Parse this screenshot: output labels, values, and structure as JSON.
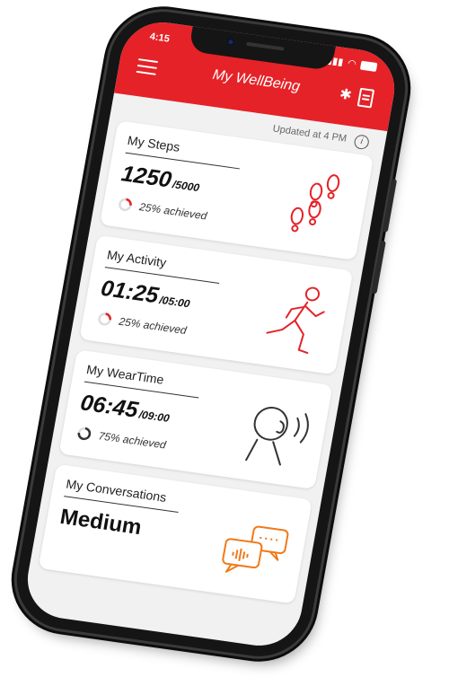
{
  "status_bar": {
    "time": "4:15"
  },
  "header": {
    "title": "My WellBeing"
  },
  "updated": {
    "text": "Updated at 4 PM"
  },
  "cards": [
    {
      "title": "My Steps",
      "value": "1250",
      "goal": "/5000",
      "progress_text": "25% achieved",
      "progress": 0.25,
      "icon": "footsteps-icon"
    },
    {
      "title": "My Activity",
      "value": "01:25",
      "goal": "/05:00",
      "progress_text": "25% achieved",
      "progress": 0.25,
      "icon": "runner-icon"
    },
    {
      "title": "My WearTime",
      "value": "06:45",
      "goal": "/09:00",
      "progress_text": "75% achieved",
      "progress": 0.75,
      "icon": "head-hearing-icon"
    },
    {
      "title": "My Conversations",
      "value": "Medium",
      "icon": "speech-bubbles-icon"
    }
  ],
  "colors": {
    "accent": "#e52228",
    "illustration": "#e52228",
    "conversation_illustration": "#f07a1a",
    "progress_low": "#e52228",
    "progress_high": "#333333"
  }
}
